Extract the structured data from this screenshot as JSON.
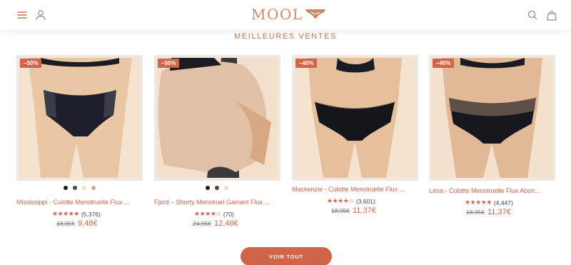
{
  "header": {
    "logo_text": "MOOL",
    "icons": [
      "menu-icon",
      "account-icon",
      "search-icon",
      "cart-icon"
    ]
  },
  "section": {
    "title": "MEILLEURES VENTES"
  },
  "colors": {
    "accent": "#d0654a",
    "text_accent": "#c8654a",
    "logo": "#c98a6a"
  },
  "products": [
    {
      "badge": "–50%",
      "name": "Mississippi - Culotte Menstruelle Flux ...",
      "stars": "★★★★★",
      "reviews": "(5.376)",
      "old_price": "18,95€",
      "new_price": "9,48€",
      "swatches": [
        "#1d1d1d",
        "#3e4a3c",
        "#f0dcc6",
        "#d4a59a"
      ]
    },
    {
      "badge": "–50%",
      "name": "Fjord – Shorty Menstruel Gainant Flux ...",
      "stars": "★★★★☆",
      "reviews": "(70)",
      "old_price": "24,95€",
      "new_price": "12,48€",
      "swatches": [
        "#1d1d1d",
        "#5a4038",
        "#f0dcc6"
      ]
    },
    {
      "badge": "–40%",
      "name": "Mackenzie - Culotte Menstruelle Flux ...",
      "stars": "★★★★☆",
      "reviews": "(3.601)",
      "old_price": "18,95€",
      "new_price": "11,37€",
      "swatches": []
    },
    {
      "badge": "–40%",
      "name": "Léna - Culotte Menstruelle Flux Abon...",
      "stars": "★★★★★",
      "reviews": "(4.447)",
      "old_price": "18,95€",
      "new_price": "11,37€",
      "swatches": []
    }
  ],
  "cta": {
    "label": "VOIR TOUT"
  }
}
